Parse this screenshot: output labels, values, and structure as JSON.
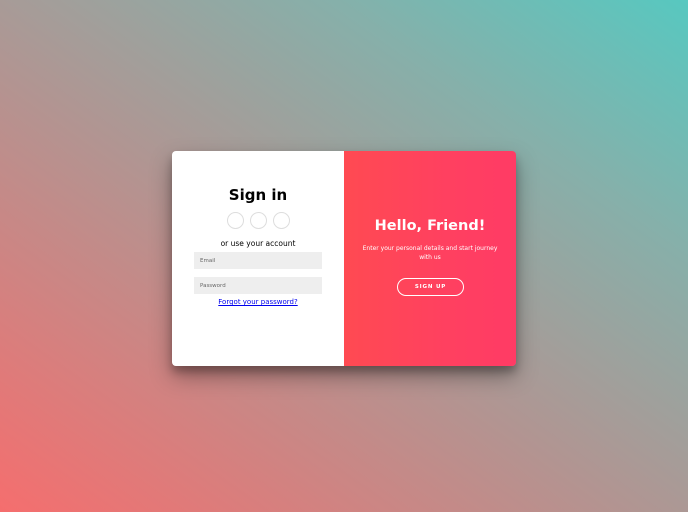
{
  "signin": {
    "title": "Sign in",
    "social_buttons": [
      {
        "icon": "facebook-icon",
        "glyph": ""
      },
      {
        "icon": "google-icon",
        "glyph": ""
      },
      {
        "icon": "linkedin-icon",
        "glyph": ""
      }
    ],
    "alt_text": "or use your account",
    "email_placeholder": "Email",
    "password_placeholder": "Password",
    "forgot_label": "Forgot your password?"
  },
  "overlay": {
    "title": "Hello, Friend!",
    "text": "Enter your personal details and start journey with us",
    "signup_label": "SIGN UP"
  },
  "colors": {
    "accent": "#ff4160",
    "background_start": "#f56e6e",
    "background_end": "#57c8c0",
    "input_background": "#eeeeee",
    "link": "#0000ee"
  }
}
